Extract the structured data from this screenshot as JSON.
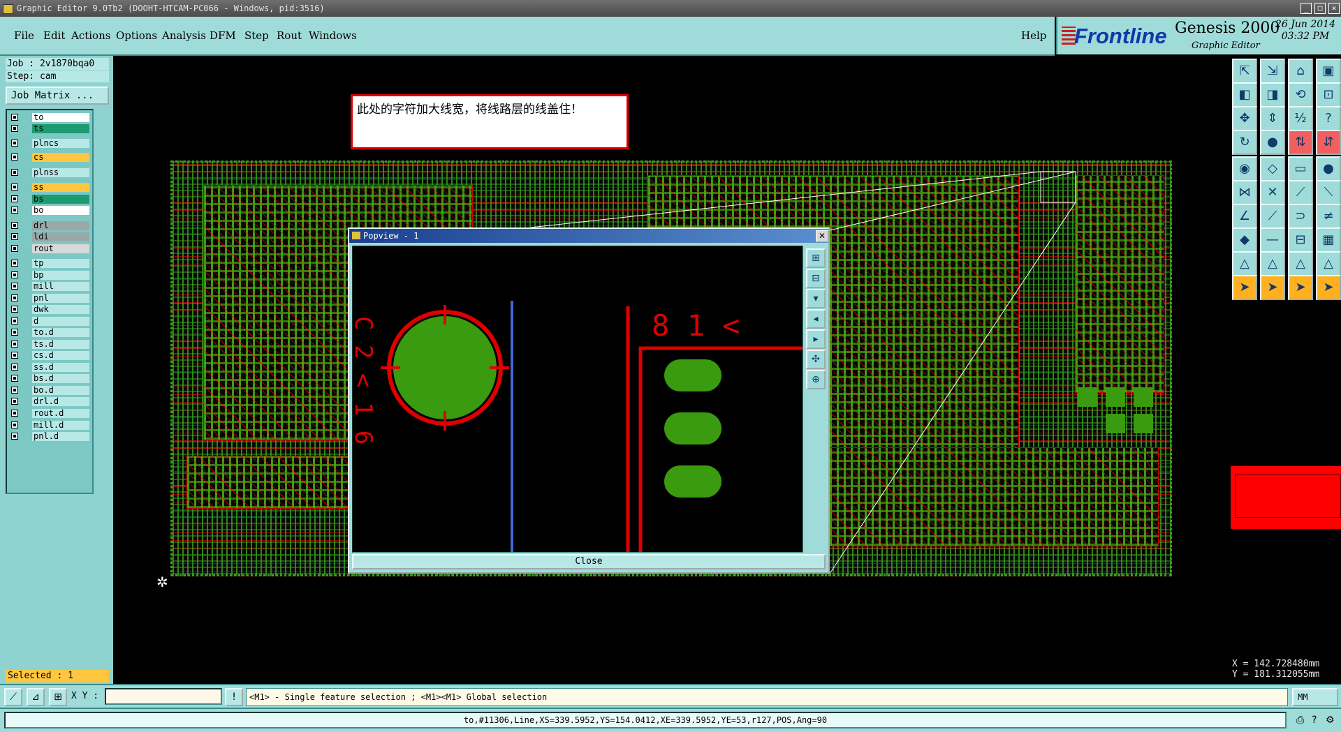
{
  "window": {
    "title": "Graphic Editor 9.0Tb2 (DOOHT-HTCAM-PC066 - Windows, pid:3516)"
  },
  "menu": [
    "File",
    "Edit",
    "Actions",
    "Options",
    "Analysis",
    "DFM",
    "Step",
    "Rout",
    "Windows"
  ],
  "help": "Help",
  "logo": {
    "brand": "Frontline",
    "product": "Genesis 2000",
    "subtitle": "Graphic Editor",
    "date": "26 Jun 2014",
    "time": "03:32 PM"
  },
  "job": {
    "job_label": "Job : 2v1870bqa0",
    "step_label": "Step: cam",
    "matrix_button": "Job Matrix ..."
  },
  "layers": [
    {
      "name": "to",
      "color": "#ffffff"
    },
    {
      "name": "ts",
      "color": "#1e9a70"
    },
    {
      "name": "plncs",
      "color": "#b8e8e6"
    },
    {
      "name": "cs",
      "color": "#ffc640"
    },
    {
      "name": "plnss",
      "color": "#b8e8e6"
    },
    {
      "name": "ss",
      "color": "#ffc640"
    },
    {
      "name": "bs",
      "color": "#1e9a70"
    },
    {
      "name": "bo",
      "color": "#ffffff"
    },
    {
      "name": "drl",
      "color": "#9aa8a8"
    },
    {
      "name": "ldi",
      "color": "#9aa8a8"
    },
    {
      "name": "rout",
      "color": "#d8d8d8"
    },
    {
      "name": "tp",
      "color": "#b8e8e6"
    },
    {
      "name": "bp",
      "color": "#b8e8e6"
    },
    {
      "name": "mill",
      "color": "#b8e8e6"
    },
    {
      "name": "pnl",
      "color": "#b8e8e6"
    },
    {
      "name": "dwk",
      "color": "#b8e8e6"
    },
    {
      "name": "d",
      "color": "#b8e8e6"
    },
    {
      "name": "to.d",
      "color": "#b8e8e6"
    },
    {
      "name": "ts.d",
      "color": "#b8e8e6"
    },
    {
      "name": "cs.d",
      "color": "#b8e8e6"
    },
    {
      "name": "ss.d",
      "color": "#b8e8e6"
    },
    {
      "name": "bs.d",
      "color": "#b8e8e6"
    },
    {
      "name": "bo.d",
      "color": "#b8e8e6"
    },
    {
      "name": "drl.d",
      "color": "#b8e8e6"
    },
    {
      "name": "rout.d",
      "color": "#b8e8e6"
    },
    {
      "name": "mill.d",
      "color": "#b8e8e6"
    },
    {
      "name": "pnl.d",
      "color": "#b8e8e6"
    }
  ],
  "selected": "Selected : 1",
  "annotation": "此处的字符加大线宽，将线路层的线盖住！",
  "popview": {
    "title": "Popview - 1",
    "close_label": "Close",
    "close_x": "✕",
    "silk_text_right": "8 1 <",
    "silk_text_left": "C 2 < 1 6"
  },
  "coords": {
    "x": "X = 142.728480mm",
    "y": "Y = 181.312055mm"
  },
  "cmdbar": {
    "xy_label": "X Y :",
    "xy_value": "",
    "hint": "<M1> - Single feature selection ; <M1><M1> Global selection",
    "units": "MM"
  },
  "status": "to,#11306,Line,XS=339.5952,YS=154.0412,XE=339.5952,YE=53,r127,POS,Ang=90",
  "colors": {
    "panel": "#9fdbd9",
    "copper": "#3a9a10",
    "silk": "#e00000",
    "accent_red": "#ff0000"
  }
}
